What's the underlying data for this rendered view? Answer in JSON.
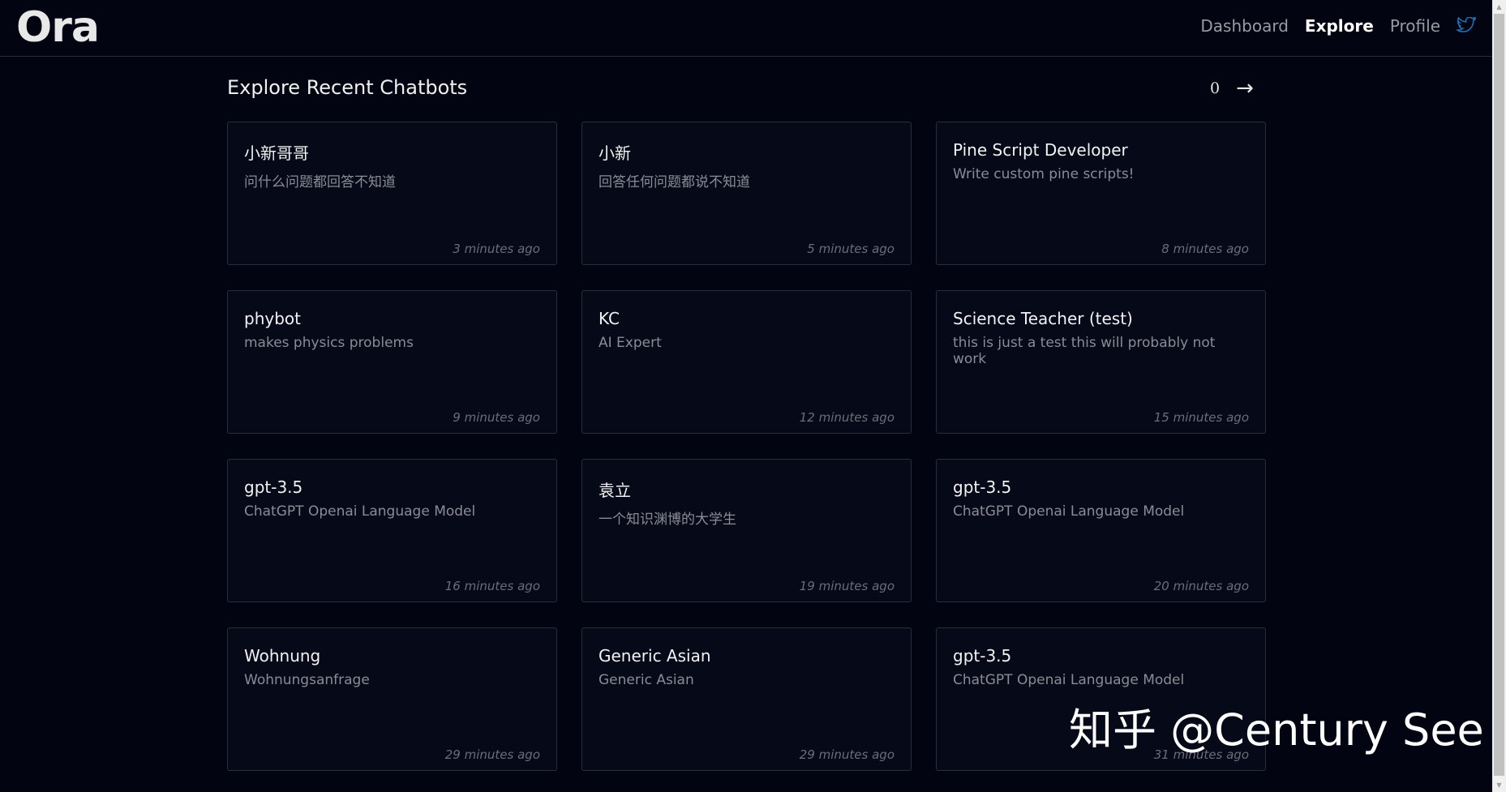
{
  "header": {
    "logo": "Ora",
    "nav": [
      {
        "label": "Dashboard",
        "active": false
      },
      {
        "label": "Explore",
        "active": true
      },
      {
        "label": "Profile",
        "active": false
      }
    ],
    "social_icon": "twitter-icon",
    "twitter_color": "#1d6fb3"
  },
  "main": {
    "title": "Explore Recent Chatbots",
    "page": "0",
    "next_arrow": "→",
    "cards": [
      {
        "name": "小新哥哥",
        "description": "问什么问题都回答不知道",
        "time": "3 minutes ago"
      },
      {
        "name": "小新",
        "description": "回答任何问题都说不知道",
        "time": "5 minutes ago"
      },
      {
        "name": "Pine Script Developer",
        "description": "Write custom pine scripts!",
        "time": "8 minutes ago"
      },
      {
        "name": "phybot",
        "description": "makes physics problems",
        "time": "9 minutes ago"
      },
      {
        "name": "KC",
        "description": "AI Expert",
        "time": "12 minutes ago"
      },
      {
        "name": "Science Teacher (test)",
        "description": "this is just a test this will probably not work",
        "time": "15 minutes ago"
      },
      {
        "name": "gpt-3.5",
        "description": "ChatGPT Openai Language Model",
        "time": "16 minutes ago"
      },
      {
        "name": "袁立",
        "description": "一个知识渊博的大学生",
        "time": "19 minutes ago"
      },
      {
        "name": "gpt-3.5",
        "description": "ChatGPT Openai Language Model",
        "time": "20 minutes ago"
      },
      {
        "name": "Wohnung",
        "description": "Wohnungsanfrage",
        "time": "29 minutes ago"
      },
      {
        "name": "Generic Asian",
        "description": "Generic Asian",
        "time": "29 minutes ago"
      },
      {
        "name": "gpt-3.5",
        "description": "ChatGPT Openai Language Model",
        "time": "31 minutes ago"
      }
    ]
  },
  "watermark": "知乎 @Century See"
}
